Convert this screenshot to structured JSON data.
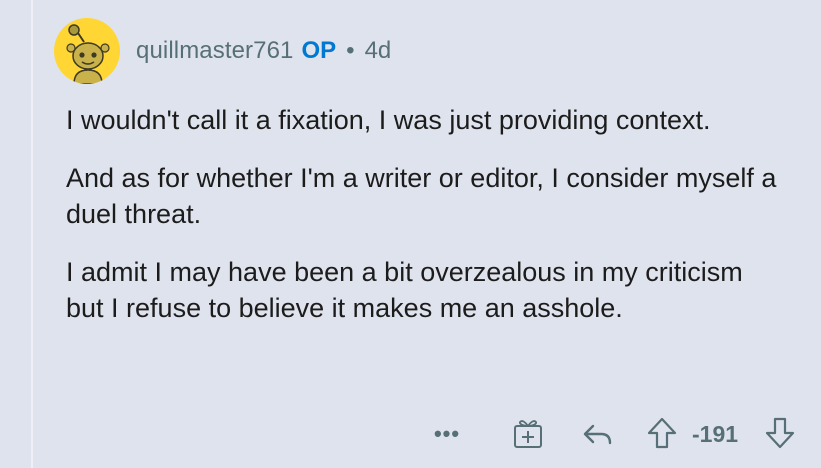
{
  "comment": {
    "username": "quillmaster761",
    "op_badge": "OP",
    "separator": "•",
    "age": "4d",
    "paragraphs": [
      "I wouldn't call it a fixation, I was just providing context.",
      "And as for whether I'm a writer or editor, I consider myself a duel threat.",
      "I admit I may have been a bit overzealous in my criticism but I refuse to believe it makes me an asshole."
    ]
  },
  "actions": {
    "more_label": "•••",
    "score": "-191",
    "award_icon": "award-gift-icon",
    "reply_icon": "reply-arrow-icon",
    "upvote_icon": "upvote-arrow-icon",
    "downvote_icon": "downvote-arrow-icon"
  },
  "colors": {
    "background": "#dfe3ed",
    "avatar_bg": "#ffd634",
    "op_blue": "#0079d3",
    "meta_gray": "#576f76",
    "text": "#1c1c1c"
  }
}
